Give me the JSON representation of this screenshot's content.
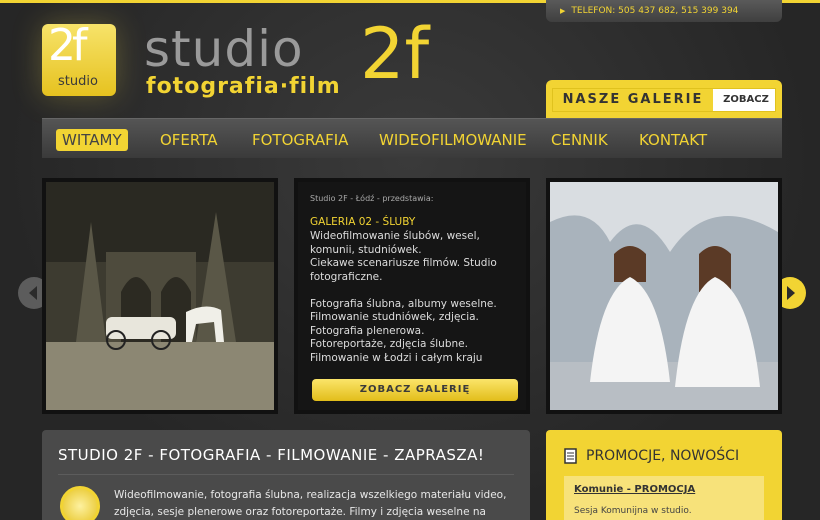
{
  "header": {
    "phone": "TELEFON: 505 437 682, 515 399 394",
    "logo_num": "2f",
    "logo_small": "studio",
    "brand_word": "studio",
    "brand_tagline": "fotografia·film",
    "brand_2f": "2f"
  },
  "galerie": {
    "label": "NASZE GALERIE",
    "button": "ZOBACZ"
  },
  "nav": [
    {
      "label": "WITAMY",
      "active": true
    },
    {
      "label": "OFERTA"
    },
    {
      "label": "FOTOGRAFIA"
    },
    {
      "label": "WIDEOFILMOWANIE"
    },
    {
      "label": "CENNIK"
    },
    {
      "label": "KONTAKT"
    }
  ],
  "slider": {
    "intro": "Studio 2F - Łódź - przedstawia:",
    "gallery_title": "GALERIA 02 - ŚLUBY",
    "text": "Wideofilmowanie ślubów, wesel, komunii, studniówek.\nCiekawe scenariusze filmów. Studio fotograficzne.\n\nFotografia ślubna, albumy weselne.\nFilmowanie studniówek, zdjęcia.\nFotografia plenerowa.\nFotoreportaże, zdjęcia ślubne.\nFilmowanie w Łodzi i całym kraju",
    "button": "ZOBACZ GALERIĘ"
  },
  "about": {
    "heading": "STUDIO 2F - FOTOGRAFIA - FILMOWANIE - ZAPRASZA!",
    "body": "Wideofilmowanie, fotografia ślubna, realizacja wszelkiego materiału video, zdjęcia, sesje plenerowe oraz fotoreportaże. Filmy i zdjęcia weselne na DVD."
  },
  "promo": {
    "title": "PROMOCJE, NOWOŚCI",
    "link": "Komunie - PROMOCJA",
    "sub": "Sesja Komunijna w studio."
  },
  "colors": {
    "accent": "#f2d433",
    "dark": "#2b2b2b"
  }
}
